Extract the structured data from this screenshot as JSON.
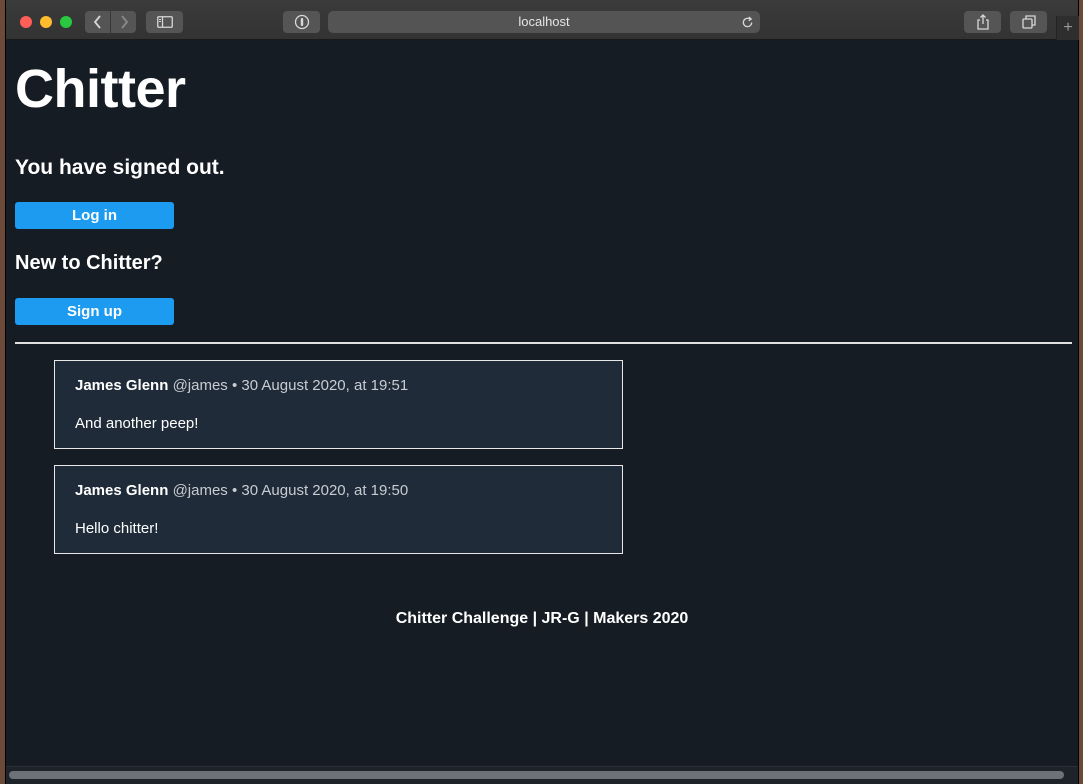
{
  "browser": {
    "url": "localhost",
    "icons": {
      "back": "chevron-left-icon",
      "forward": "chevron-right-icon",
      "sidebar": "sidebar-icon",
      "privacy": "password-icon",
      "reload": "reload-icon",
      "share": "share-icon",
      "tabs": "tabs-icon",
      "new_tab": "plus-icon"
    },
    "colors": {
      "close": "#ff5f57",
      "minimize": "#febc2e",
      "maximize": "#28c840"
    }
  },
  "page": {
    "title": "Chitter",
    "status": "You have signed out.",
    "login_label": "Log in",
    "new_prompt": "New to Chitter?",
    "signup_label": "Sign up",
    "accent_color": "#1d9bf0",
    "background_color": "#161c23"
  },
  "peeps": [
    {
      "name": "James Glenn",
      "meta": "@james • 30 August 2020, at 19:51",
      "text": "And another peep!"
    },
    {
      "name": "James Glenn",
      "meta": "@james • 30 August 2020, at 19:50",
      "text": "Hello chitter!"
    }
  ],
  "footer": {
    "text": "Chitter Challenge | JR-G | Makers 2020"
  }
}
